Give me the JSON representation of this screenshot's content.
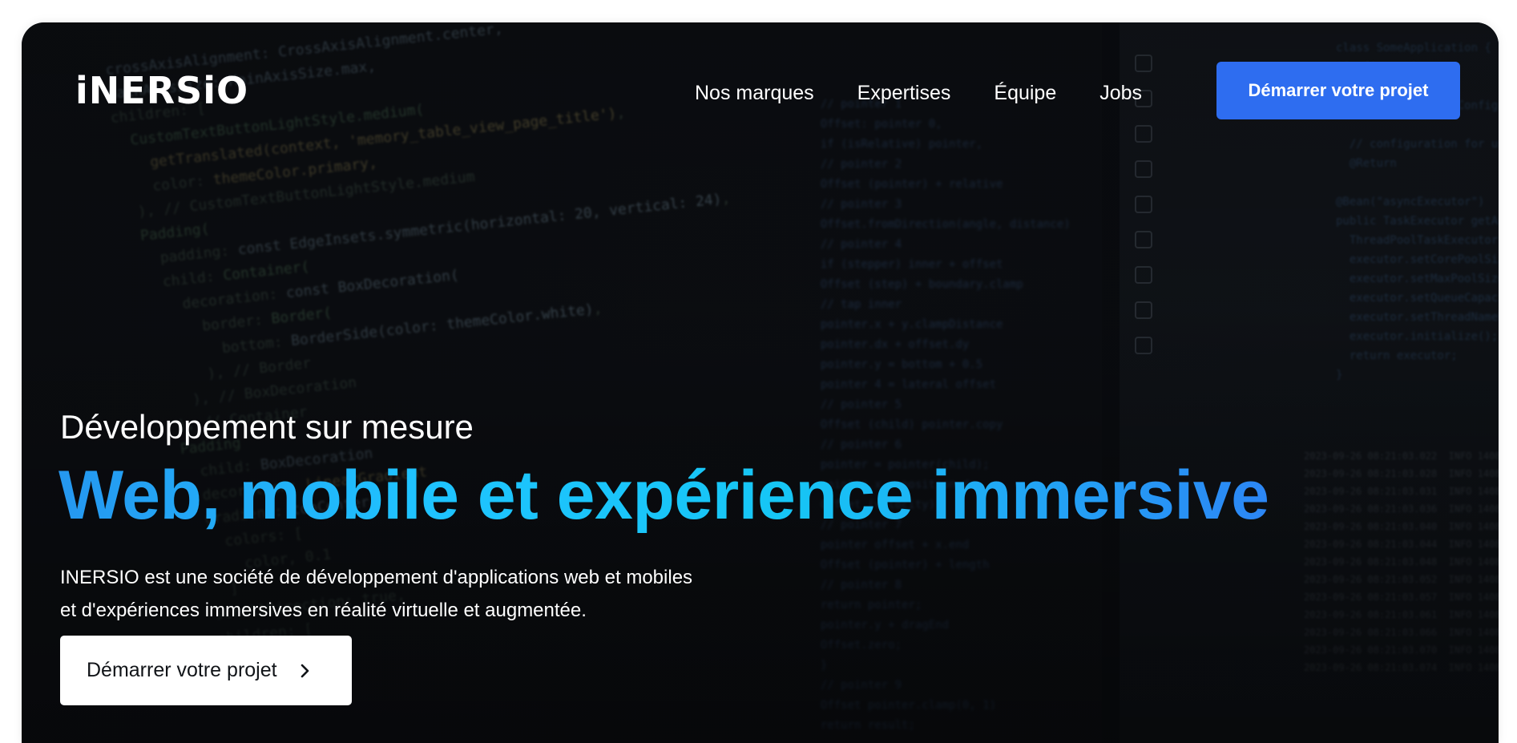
{
  "brand": {
    "logo_text": "iNERSiO"
  },
  "nav": {
    "items": [
      {
        "label": "Nos marques"
      },
      {
        "label": "Expertises"
      },
      {
        "label": "Équipe"
      },
      {
        "label": "Jobs"
      }
    ],
    "cta_label": "Démarrer votre projet"
  },
  "hero": {
    "subtitle": "Développement sur mesure",
    "headline": "Web, mobile et expérience immersive",
    "description_lines": [
      "INERSIO est une société de développement d'applications web et mobiles",
      "et d'expériences immersives en réalité virtuelle et augmentée."
    ],
    "cta_label": "Démarrer votre projet",
    "cta_icon": "chevron-right-icon"
  },
  "colors": {
    "accent": "#2e6df0",
    "headline_gradient": [
      "#2597f0",
      "#1fc3ff",
      "#2c86f5"
    ],
    "background": "#0d0f13"
  }
}
